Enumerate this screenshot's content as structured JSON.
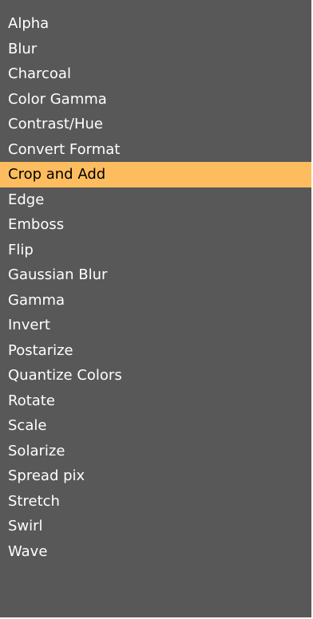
{
  "menu": {
    "items": [
      {
        "label": "Alpha"
      },
      {
        "label": "Blur"
      },
      {
        "label": "Charcoal"
      },
      {
        "label": "Color Gamma"
      },
      {
        "label": "Contrast/Hue"
      },
      {
        "label": "Convert Format"
      },
      {
        "label": "Crop and Add",
        "highlighted": true
      },
      {
        "label": "Edge"
      },
      {
        "label": "Emboss"
      },
      {
        "label": "Flip"
      },
      {
        "label": "Gaussian Blur"
      },
      {
        "label": "Gamma"
      },
      {
        "label": "Invert"
      },
      {
        "label": "Postarize"
      },
      {
        "label": "Quantize Colors"
      },
      {
        "label": "Rotate"
      },
      {
        "label": "Scale"
      },
      {
        "label": "Solarize"
      },
      {
        "label": "Spread pix"
      },
      {
        "label": "Stretch"
      },
      {
        "label": "Swirl"
      },
      {
        "label": "Wave"
      }
    ],
    "colors": {
      "background": "#585858",
      "text": "#ffffff",
      "highlight_background": "#fdbd5e",
      "highlight_text": "#000000"
    }
  }
}
